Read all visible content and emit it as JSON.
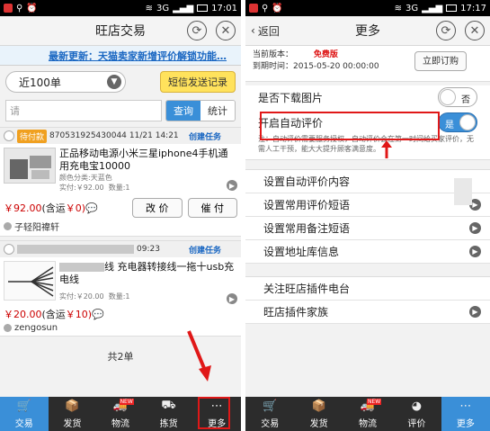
{
  "left": {
    "status": {
      "time": "17:01",
      "signal": "3G"
    },
    "title": "旺店交易",
    "notice": "最新更新：天猫卖家新增评价解锁功能…",
    "filter": {
      "selected": "近100单",
      "sms_label": "短信发送记录"
    },
    "search": {
      "placeholder": "请",
      "btn_query": "查询",
      "btn_stats": "统计"
    },
    "orders": [
      {
        "status_badge": "待付款",
        "order_no": "870531925430044",
        "time": "11/21 14:21",
        "task": "创建任务",
        "title": "正品移动电源小米三星iphone4手机通用充电宝10000",
        "color": "颜色分类:天蓝色",
        "paid": "实付:￥92.00",
        "qty": "数量:1",
        "price": "￥92.00",
        "ship": "(含运",
        "ship_fee": "￥0)",
        "btn1": "改 价",
        "btn2": "催 付",
        "buyer": "子轻阳禕轩"
      },
      {
        "time": "09:23",
        "task": "创建任务",
        "title": "线 充电器转接线一拖十usb充电线",
        "paid": "实付:￥20.00",
        "qty": "数量:1",
        "price": "￥20.00",
        "ship": "(含运",
        "ship_fee": "￥10)",
        "buyer": "zengosun"
      }
    ],
    "total": "共2单",
    "tabs": [
      "交易",
      "发货",
      "物流",
      "拣货",
      "更多"
    ],
    "new_badge": "NEW"
  },
  "right": {
    "status": {
      "time": "17:17",
      "signal": "3G"
    },
    "back": "返回",
    "title": "更多",
    "info": {
      "version_label": "当前版本：",
      "version_value": "免费版",
      "expiry_label": "到期时间：",
      "expiry_value": "2015-05-20 00:00:00",
      "subscribe": "立即订购"
    },
    "toggle1": {
      "label": "是否下载图片",
      "state": "否"
    },
    "toggle2": {
      "label": "开启自动评价",
      "state": "是"
    },
    "hint": "注：自动评价需要服务授权，自动评价会在第一时间给买家评价，无需人工干预，能大大提升顾客满意度。",
    "menu1": [
      "设置自动评价内容",
      "设置常用评价短语",
      "设置常用备注短语",
      "设置地址库信息"
    ],
    "menu2": [
      "关注旺店插件电台",
      "旺店插件家族"
    ],
    "tabs": [
      "交易",
      "发货",
      "物流",
      "评价",
      "更多"
    ],
    "new_badge": "NEW"
  },
  "colors": {
    "accent": "#3a8fd8",
    "highlight": "#e01818",
    "tabbar": "#2c2c2c",
    "notice": "#1a67c2"
  },
  "icons": [
    "refresh-icon",
    "close-icon",
    "back-chevron-icon",
    "cart-icon",
    "box-icon",
    "truck-icon",
    "hand-cart-icon",
    "more-icon",
    "pacman-icon"
  ]
}
